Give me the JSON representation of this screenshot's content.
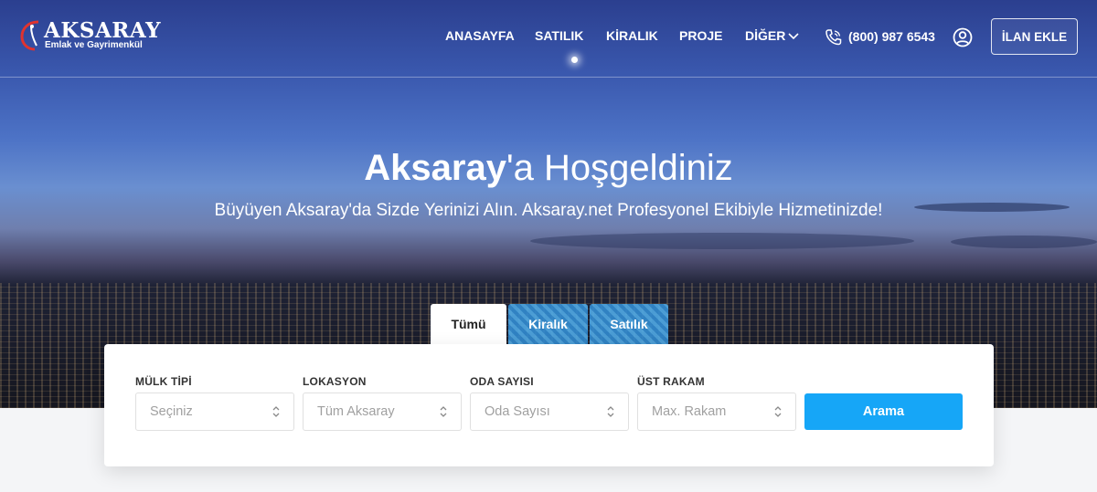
{
  "brand": {
    "name": "AKSARAY",
    "tagline": "Emlak ve Gayrimenkül"
  },
  "nav": {
    "items": [
      "ANASAYFA",
      "SATILIK",
      "KİRALIK",
      "PROJE",
      "DİĞER"
    ],
    "phone": "(800) 987 6543",
    "add_listing": "İLAN EKLE"
  },
  "hero": {
    "title_bold": "Aksaray",
    "title_rest": "'a Hoşgeldiniz",
    "subtitle": "Büyüyen Aksaray'da Sizde Yerinizi Alın. Aksaray.net Profesyonel Ekibiyle Hizmetinizde!"
  },
  "tabs": [
    "Tümü",
    "Kiralık",
    "Satılık"
  ],
  "search": {
    "fields": [
      {
        "label": "MÜLK TİPİ",
        "value": "Seçiniz"
      },
      {
        "label": "LOKASYON",
        "value": "Tüm Aksaray"
      },
      {
        "label": "ODA SAYISI",
        "value": "Oda Sayısı"
      },
      {
        "label": "ÜST RAKAM",
        "value": "Max. Rakam"
      }
    ],
    "button": "Arama"
  },
  "colors": {
    "accent": "#16a6f7",
    "logo_red": "#e0332f"
  },
  "icons": [
    "phone-icon",
    "user-icon",
    "chevron-down-icon",
    "select-arrows-icon"
  ]
}
